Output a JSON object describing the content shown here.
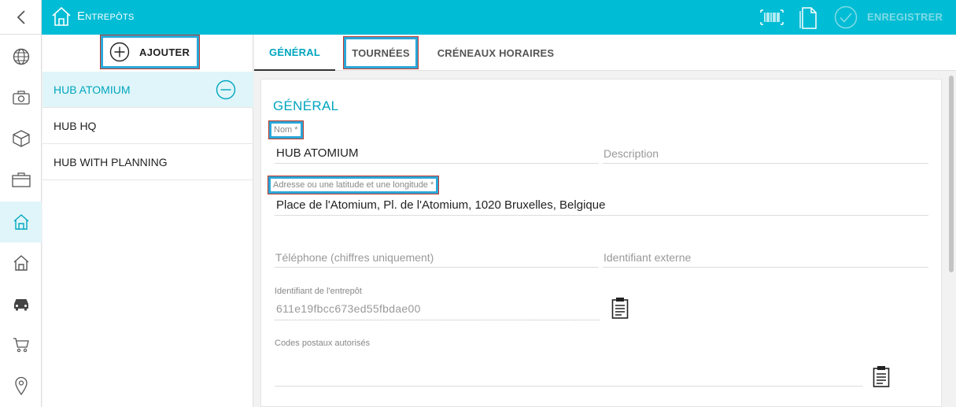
{
  "topbar": {
    "title": "Entrepôts",
    "save_label": "ENREGISTRER",
    "icons": [
      "home-icon",
      "barcode-icon",
      "document-icon",
      "check-circle-icon"
    ]
  },
  "rail": {
    "icons": [
      "chevron-left-icon",
      "globe-icon",
      "camera-icon",
      "box-icon",
      "briefcase-icon",
      "warehouse-icon",
      "house-icon",
      "car-icon",
      "cart-icon",
      "pin-icon"
    ],
    "active": "warehouse-icon"
  },
  "list": {
    "add_label": "AJOUTER",
    "items": [
      {
        "label": "HUB ATOMIUM",
        "selected": true
      },
      {
        "label": "HUB HQ",
        "selected": false
      },
      {
        "label": "HUB WITH PLANNING",
        "selected": false
      }
    ]
  },
  "tabs": [
    {
      "label": "GÉNÉRAL",
      "active": true
    },
    {
      "label": "TOURNÉES",
      "active": false
    },
    {
      "label": "CRÉNEAUX HORAIRES",
      "active": false
    }
  ],
  "form": {
    "section_title": "GÉNÉRAL",
    "name_label": "Nom *",
    "name_value": "HUB ATOMIUM",
    "description_placeholder": "Description",
    "address_label": "Adresse ou une latitude et une longitude *",
    "address_value": "Place de l'Atomium, Pl. de l'Atomium, 1020 Bruxelles, Belgique",
    "phone_placeholder": "Téléphone (chiffres uniquement)",
    "external_id_placeholder": "Identifiant externe",
    "warehouse_id_label": "Identifiant de l'entrepôt",
    "warehouse_id_value": "611e19fbcc673ed55fbdae00",
    "postal_codes_label": "Codes postaux autorisés"
  },
  "colors": {
    "accent": "#00bcd4",
    "accent_text": "#00a6bf",
    "highlight_border": "#2aa7d8"
  }
}
